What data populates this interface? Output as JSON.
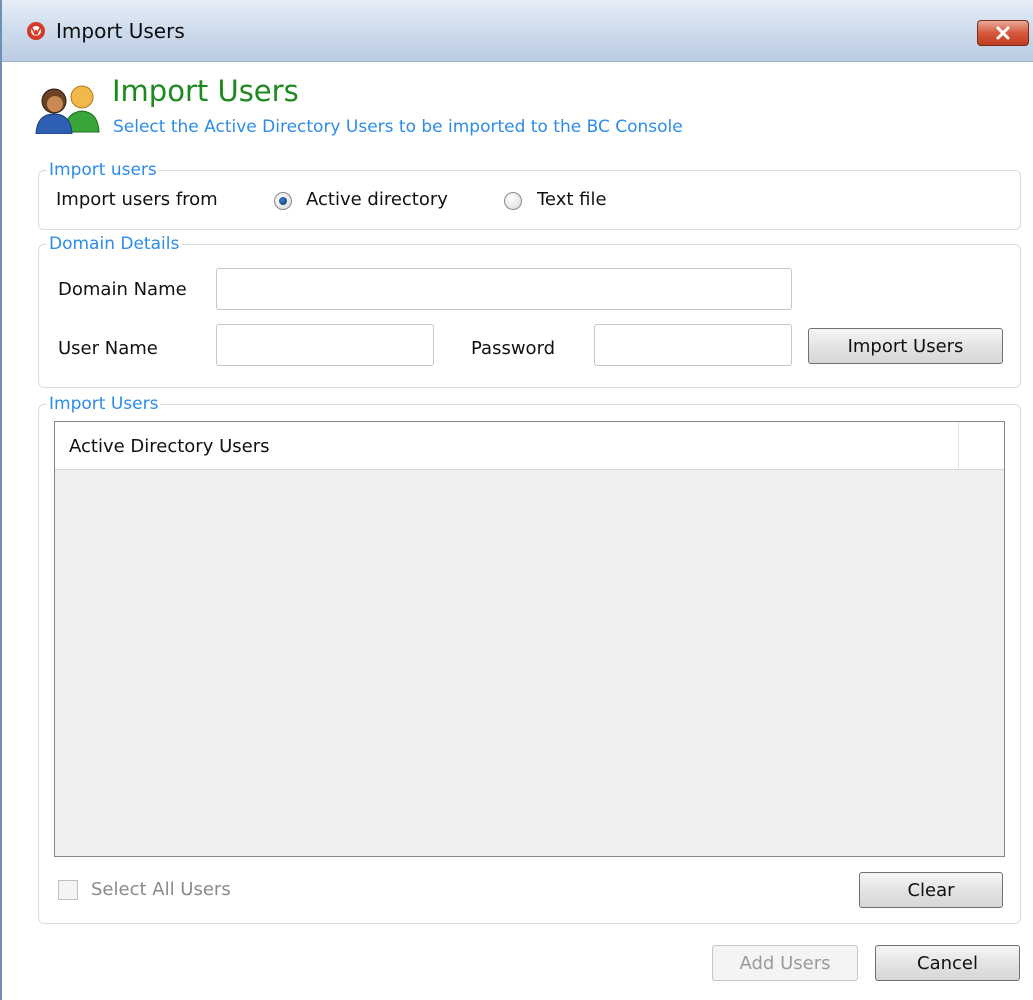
{
  "window": {
    "title": "Import Users",
    "icon": "app-logo-icon",
    "close_icon": "close-icon"
  },
  "header": {
    "title": "Import Users",
    "subtitle": "Select the Active Directory Users to be imported to the BC Console",
    "icon": "users-icon"
  },
  "import_group": {
    "legend": "Import users",
    "from_label": "Import users from",
    "options": [
      {
        "label": "Active directory",
        "selected": true
      },
      {
        "label": "Text file",
        "selected": false
      }
    ]
  },
  "domain_group": {
    "legend": "Domain Details",
    "domain_label": "Domain Name",
    "domain_value": "",
    "user_label": "User Name",
    "user_value": "",
    "password_label": "Password",
    "password_value": "",
    "import_button": "Import Users"
  },
  "users_group": {
    "legend": "Import Users",
    "column_header": "Active Directory Users",
    "rows": [],
    "select_all_label": "Select All Users",
    "select_all_checked": false,
    "select_all_enabled": false,
    "clear_button": "Clear"
  },
  "footer": {
    "add_button": "Add Users",
    "add_enabled": false,
    "cancel_button": "Cancel"
  },
  "colors": {
    "heading_green": "#1e8a1e",
    "accent_blue": "#2d8ce6",
    "close_red": "#c03d20"
  }
}
